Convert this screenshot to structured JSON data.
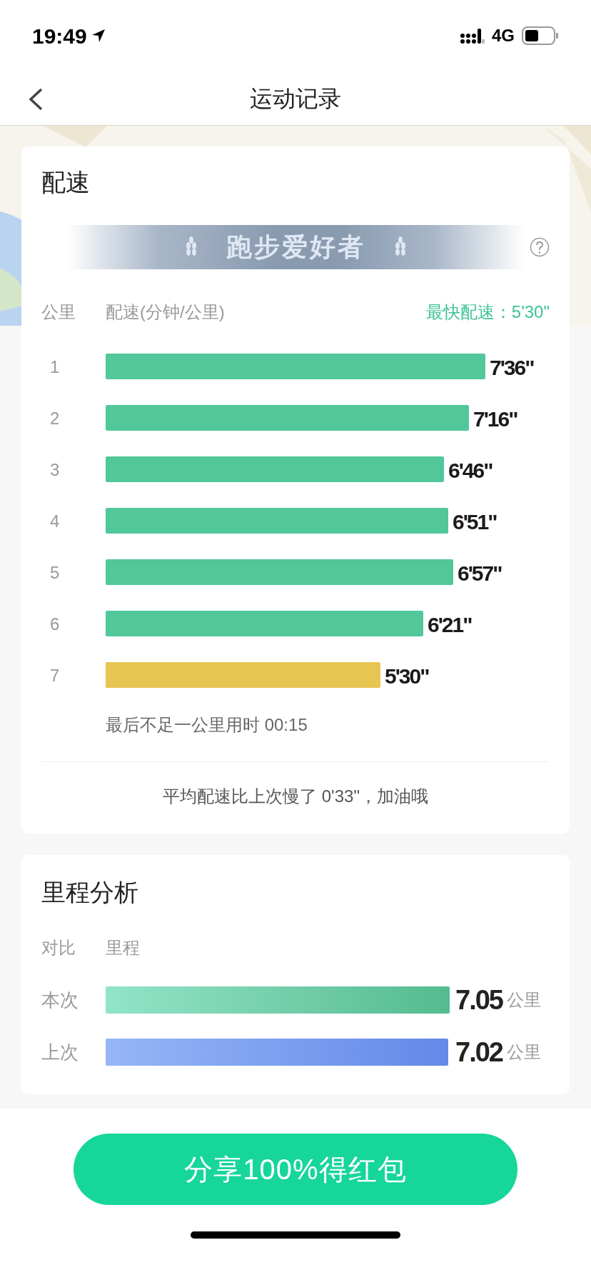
{
  "status_bar": {
    "time": "19:49",
    "network": "4G"
  },
  "nav": {
    "title": "运动记录"
  },
  "pace_card": {
    "title": "配速",
    "badge": "跑步爱好者",
    "columns": {
      "km": "公里",
      "pace": "配速(分钟/公里)",
      "fastest": "最快配速：5'30\""
    },
    "rows": [
      {
        "km": "1",
        "pace": "7'36\"",
        "color": "#52c79a"
      },
      {
        "km": "2",
        "pace": "7'16\"",
        "color": "#52c79a"
      },
      {
        "km": "3",
        "pace": "6'46\"",
        "color": "#52c79a"
      },
      {
        "km": "4",
        "pace": "6'51\"",
        "color": "#52c79a"
      },
      {
        "km": "5",
        "pace": "6'57\"",
        "color": "#52c79a"
      },
      {
        "km": "6",
        "pace": "6'21\"",
        "color": "#52c79a"
      },
      {
        "km": "7",
        "pace": "5'30\"",
        "color": "#e8c552"
      }
    ],
    "note": "最后不足一公里用时 00:15",
    "summary": "平均配速比上次慢了 0'33\"，加油哦"
  },
  "distance_card": {
    "title": "里程分析",
    "columns": {
      "compare": "对比",
      "distance": "里程"
    },
    "rows": [
      {
        "label": "本次",
        "value": "7.05",
        "unit": "公里",
        "kind": "current"
      },
      {
        "label": "上次",
        "value": "7.02",
        "unit": "公里",
        "kind": "previous"
      }
    ]
  },
  "share_button": "分享100%得红包"
}
